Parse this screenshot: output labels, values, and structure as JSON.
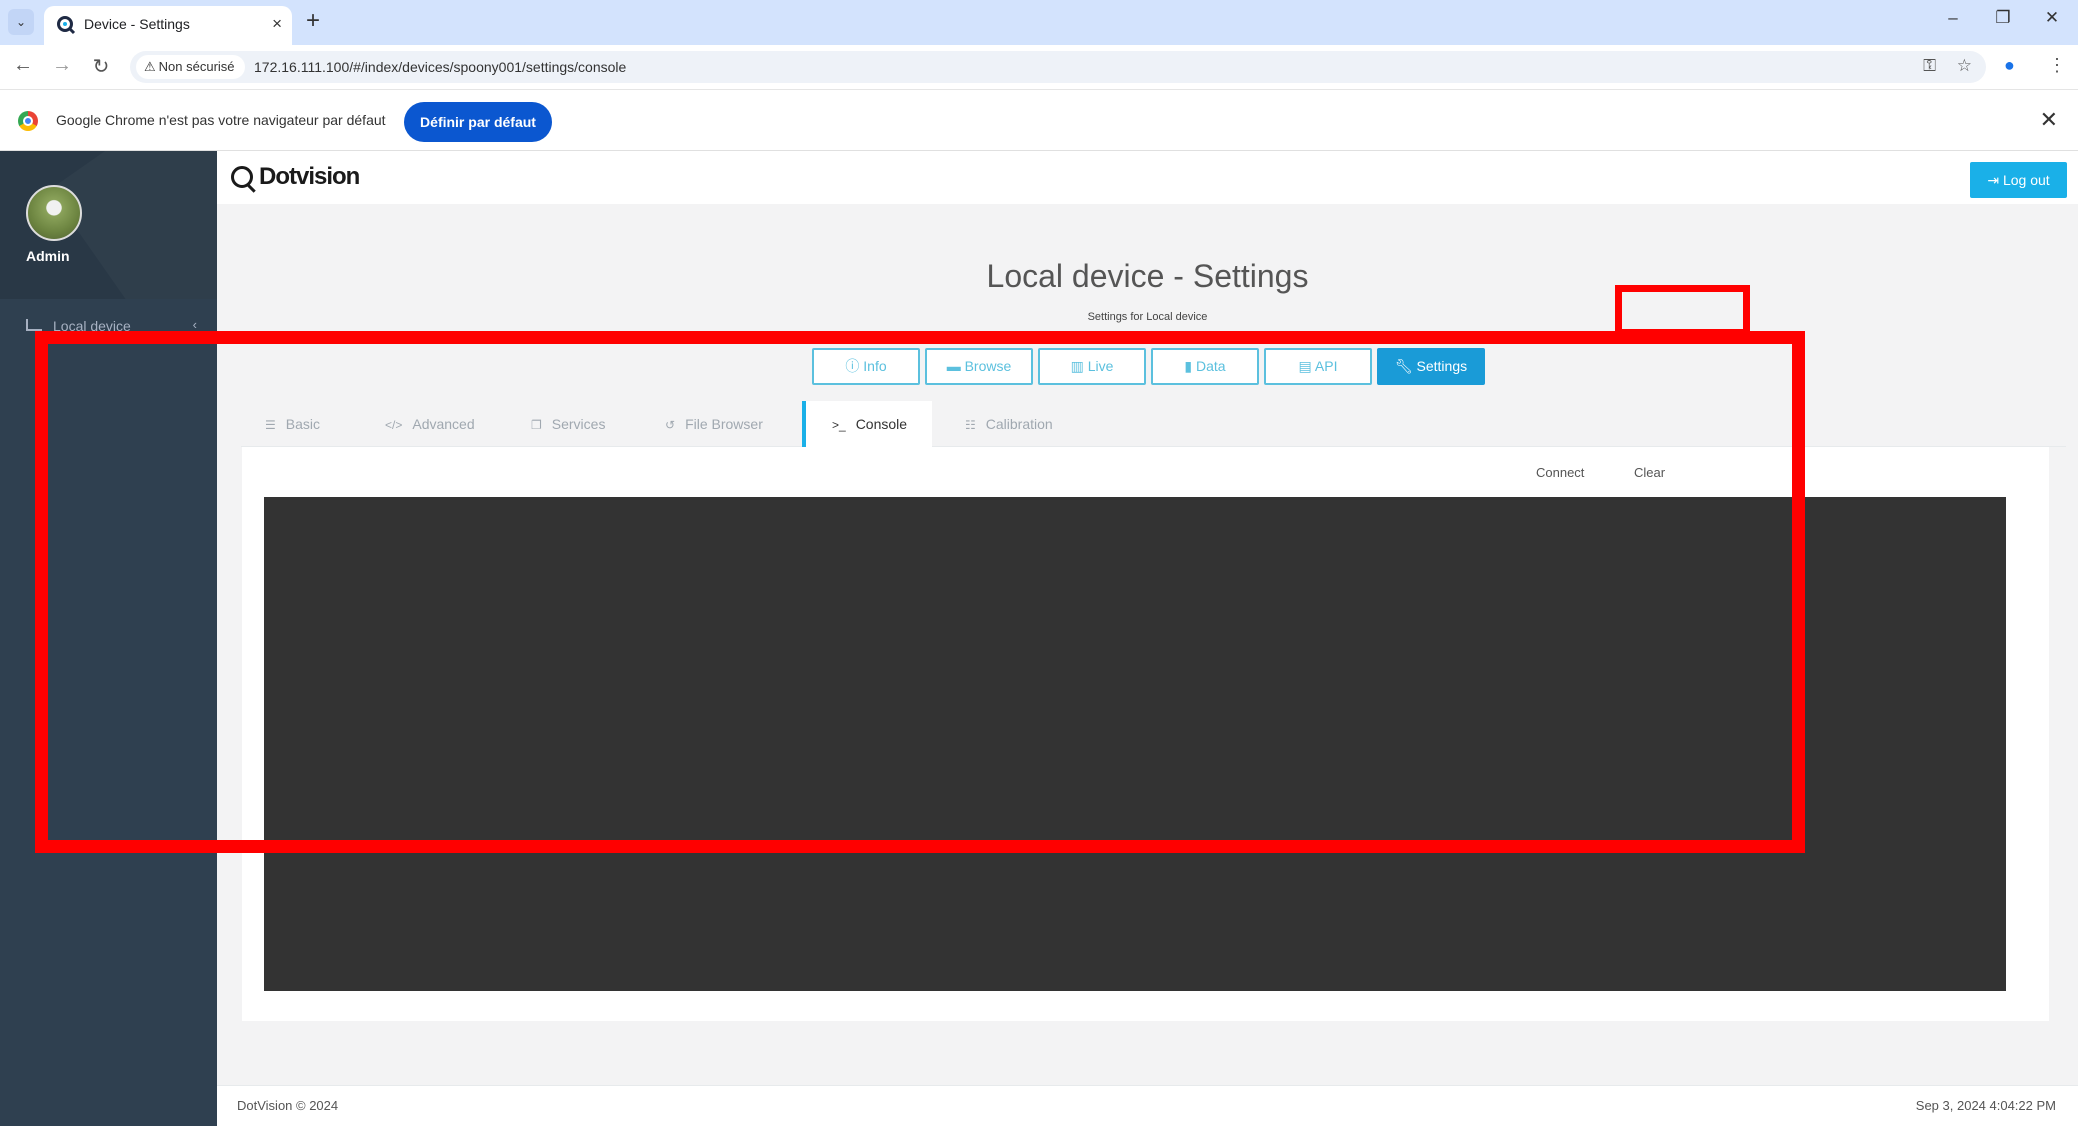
{
  "browser": {
    "tab_title": "Device - Settings",
    "new_tab_glyph": "+",
    "tab_close_glyph": "×",
    "address_security": "Non sécurisé",
    "url": "172.16.111.100/#/index/devices/spoony001/settings/console",
    "infobar": {
      "message": "Google Chrome n'est pas votre navigateur par défaut",
      "button": "Définir par défaut"
    },
    "icons": [
      "tab-list-icon",
      "back-icon",
      "forward-icon",
      "reload-icon",
      "warning-icon",
      "password-key-icon",
      "star-icon",
      "profile-icon",
      "menu-icon",
      "minimize-icon",
      "restore-icon",
      "close-icon"
    ]
  },
  "sidebar": {
    "user": "Admin",
    "items": [
      {
        "label": "Local device",
        "icon": "area-chart-icon"
      }
    ]
  },
  "header": {
    "brand": "Dotvision",
    "logout": "Log out"
  },
  "page": {
    "title": "Local device - Settings",
    "subtitle": "Settings for Local device"
  },
  "nav_buttons": [
    {
      "label": "Info",
      "icon": "info-icon"
    },
    {
      "label": "Browse",
      "icon": "folder-icon"
    },
    {
      "label": "Live",
      "icon": "bar-chart-icon"
    },
    {
      "label": "Data",
      "icon": "file-icon"
    },
    {
      "label": "API",
      "icon": "window-icon"
    },
    {
      "label": "Settings",
      "icon": "wrench-icon",
      "active": true
    }
  ],
  "settings_tabs": [
    {
      "label": "Basic",
      "icon": "list-icon"
    },
    {
      "label": "Advanced",
      "icon": "code-icon"
    },
    {
      "label": "Services",
      "icon": "copy-icon"
    },
    {
      "label": "File Browser",
      "icon": "history-icon"
    },
    {
      "label": "Console",
      "icon": "terminal-icon",
      "active": true
    },
    {
      "label": "Calibration",
      "icon": "sliders-icon"
    }
  ],
  "console": {
    "connect": "Connect",
    "clear": "Clear"
  },
  "footer": {
    "copyright": "DotVision © 2024",
    "timestamp": "Sep 3, 2024 4:04:22 PM"
  },
  "colors": {
    "sidebar": "#2f4050",
    "accent": "#1ab0e8",
    "console_bg": "#333333",
    "annotation": "#ff0000"
  }
}
